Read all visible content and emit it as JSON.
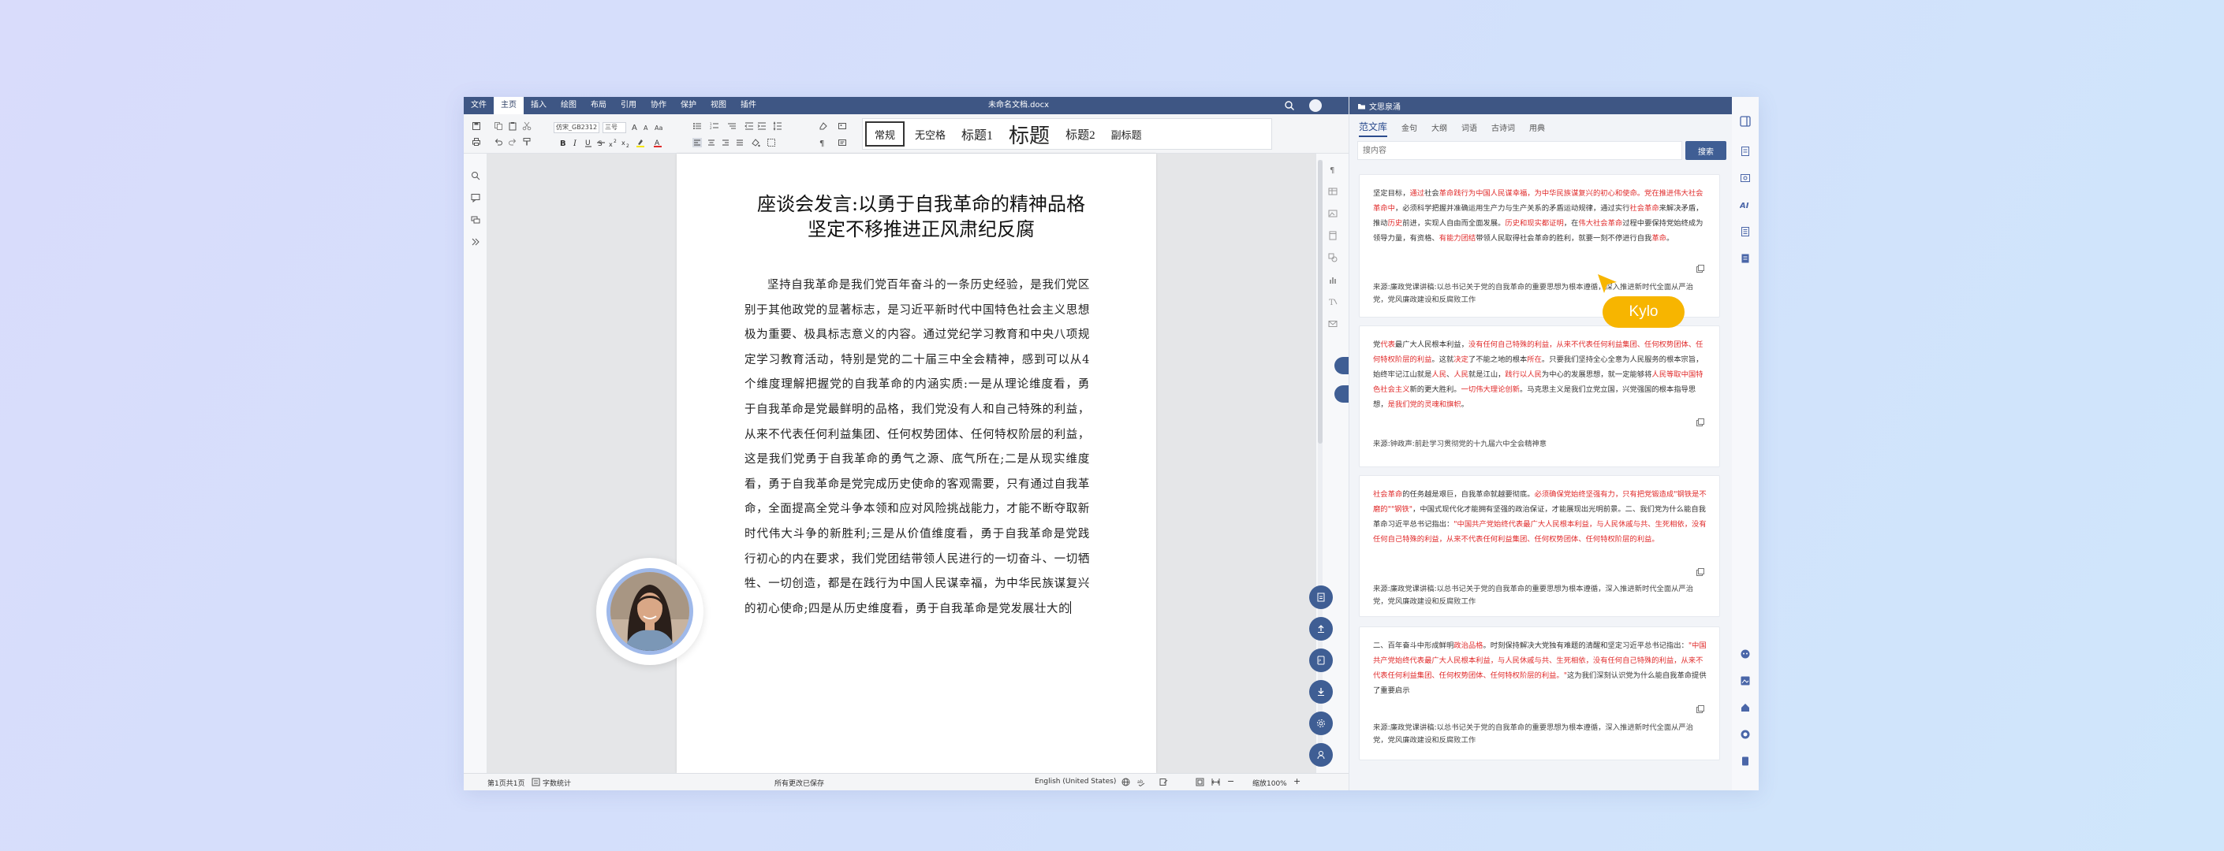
{
  "editor": {
    "menu": [
      "文件",
      "主页",
      "插入",
      "绘图",
      "布局",
      "引用",
      "协作",
      "保护",
      "视图",
      "插件"
    ],
    "active_menu_index": 1,
    "doc_filename": "未命名文档.docx",
    "font_name": "仿宋_GB2312",
    "font_size": "三号",
    "styles": [
      "常规",
      "无空格",
      "标题1",
      "标题",
      "标题2",
      "副标题"
    ],
    "selected_style": "常规",
    "heading": "座谈会发言:以勇于自我革命的精神品格坚定不移推进正风肃纪反腐",
    "body": "坚持自我革命是我们党百年奋斗的一条历史经验，是我们党区别于其他政党的显著标志，是习近平新时代中国特色社会主义思想极为重要、极具标志意义的内容。通过党纪学习教育和中央八项规定学习教育活动，特别是党的二十届三中全会精神，感到可以从4个维度理解把握党的自我革命的内涵实质:一是从理论维度看，勇于自我革命是党最鲜明的品格，我们党没有人和自己特殊的利益，从来不代表任何利益集团、任何权势团体、任何特权阶层的利益，这是我们党勇于自我革命的勇气之源、底气所在;二是从现实维度看，勇于自我革命是党完成历史使命的客观需要，只有通过自我革命，全面提高全党斗争本领和应对风险挑战能力，才能不断夺取新时代伟大斗争的新胜利;三是从价值维度看，勇于自我革命是党践行初心的内在要求，我们党团结带领人民进行的一切奋斗、一切牺牲、一切创造，都是在践行为中国人民谋幸福，为中华民族谋复兴的初心使命;四是从历史维度看，勇于自我革命是党发展壮大的"
  },
  "status": {
    "page": "第1页共1页",
    "word_count": "字数统计",
    "saved": "所有更改已保存",
    "language": "English (United States)",
    "zoom": "缩放100%"
  },
  "panel": {
    "title": "文思泉涌",
    "tabs": [
      "范文库",
      "金句",
      "大纲",
      "词语",
      "古诗词",
      "用典"
    ],
    "active_tab": "范文库",
    "search_placeholder": "搜内容",
    "search_button": "搜索",
    "cards": [
      {
        "segments": [
          {
            "t": "坚定目标，",
            "red": false
          },
          {
            "t": "通过",
            "red": true
          },
          {
            "t": "社会",
            "red": false
          },
          {
            "t": "革命践行为中国人民谋幸福，为中华民族谋复兴的初心和使命。党在推进伟大社会革命中",
            "red": true
          },
          {
            "t": "，必须科学把握并准确运用生产力与生产关系的矛盾运动规律，通过实行",
            "red": false
          },
          {
            "t": "社会革命",
            "red": true
          },
          {
            "t": "来解决矛盾，推动",
            "red": false
          },
          {
            "t": "历史",
            "red": true
          },
          {
            "t": "前进，实现人自由而全面发展。",
            "red": false
          },
          {
            "t": "历史和现实都证明",
            "red": true
          },
          {
            "t": "，在",
            "red": false
          },
          {
            "t": "伟大社会革命",
            "red": true
          },
          {
            "t": "过程中要保持党始终成为领导力量，有资格、",
            "red": false
          },
          {
            "t": "有能力团结",
            "red": true
          },
          {
            "t": "带领人民取得社会革命的胜利，就要一刻不停进行自我",
            "red": false
          },
          {
            "t": "革命",
            "red": true
          },
          {
            "t": "。",
            "red": false
          }
        ],
        "source": "来源:廉政党课讲稿:以总书记关于党的自我革命的重要思想为根本遵循，深入推进新时代全面从严治党，党风廉政建设和反腐败工作"
      },
      {
        "segments": [
          {
            "t": "党",
            "red": false
          },
          {
            "t": "代表",
            "red": true
          },
          {
            "t": "最广大人民根本利益，",
            "red": false
          },
          {
            "t": "没有任何自己特殊的利益，从来不代表任何利益集团、任何权势团体、任何特权阶层的利益",
            "red": true
          },
          {
            "t": "。这就",
            "red": false
          },
          {
            "t": "决定",
            "red": true
          },
          {
            "t": "了不能之地的根本",
            "red": false
          },
          {
            "t": "所在",
            "red": true
          },
          {
            "t": "。只要我们坚持全心全意为人民服务的根本宗旨，始终牢记江山就是",
            "red": false
          },
          {
            "t": "人民",
            "red": true
          },
          {
            "t": "、",
            "red": false
          },
          {
            "t": "人民",
            "red": true
          },
          {
            "t": "就是江山，",
            "red": false
          },
          {
            "t": "践行以人民",
            "red": true
          },
          {
            "t": "为中心的发展思想，就一定能够将",
            "red": false
          },
          {
            "t": "人民等取中国特色社会主义",
            "red": true
          },
          {
            "t": "新的更大胜利。",
            "red": false
          },
          {
            "t": "一切伟大理论创新",
            "red": true
          },
          {
            "t": "。马克思主义是我们立党立国，兴党强国的根本指导思想，",
            "red": false
          },
          {
            "t": "是我们党的灵魂和旗帜",
            "red": true
          },
          {
            "t": "。",
            "red": false
          }
        ],
        "source": "来源:钟政声:前赴学习贯彻党的十九届六中全会精神意"
      },
      {
        "segments": [
          {
            "t": "社会革命",
            "red": true
          },
          {
            "t": "的任务越是艰巨，自我革命就越要彻底。",
            "red": false
          },
          {
            "t": "必须确保党始终坚强有力，只有把党锻造成\"钢铁是不磨的\"\"钢铁\"",
            "red": true
          },
          {
            "t": "，中国式现代化才能拥有坚强的政治保证，才能展现出光明前景。二、我们党为什么能自我革命习近平总书记指出：",
            "red": false
          },
          {
            "t": "\"中国共产党始终代表最广大人民根本利益，与人民休戚与共、生死相依，没有任何自己特殊的利益，从来不代表任何利益集团、任何权势团体、任何特权阶层的利益。",
            "red": true
          }
        ],
        "source": "来源:廉政党课讲稿:以总书记关于党的自我革命的重要思想为根本遵循，深入推进新时代全面从严治党，党风廉政建设和反腐败工作"
      },
      {
        "segments": [
          {
            "t": "二、百年奋斗中形成鲜明",
            "red": false
          },
          {
            "t": "政治品格",
            "red": true
          },
          {
            "t": "。时刻保持解决大党独有难题的清醒和坚定习近平总书记指出：",
            "red": false
          },
          {
            "t": "\"中国共产党始终代表最广大人民根本利益，与人民休戚与共、生死相依，没有任何自己特殊的利益，从来不代表任何利益集团、任何权势团体、任何特权阶层的利益。\"",
            "red": true
          },
          {
            "t": "这为我们深刻认识党为什么能自我革命提供了重要启示",
            "red": false
          }
        ],
        "source": "来源:廉政党课讲稿:以总书记关于党的自我革命的重要思想为根本遵循，深入推进新时代全面从严治党，党风廉政建设和反腐败工作"
      }
    ]
  },
  "collaborator": {
    "cursor_name": "Kylo",
    "cursor_color": "#f7b500"
  },
  "colors": {
    "brand": "#3e5684",
    "accent": "#3f5e94",
    "highlight_red": "#e02b2b"
  }
}
